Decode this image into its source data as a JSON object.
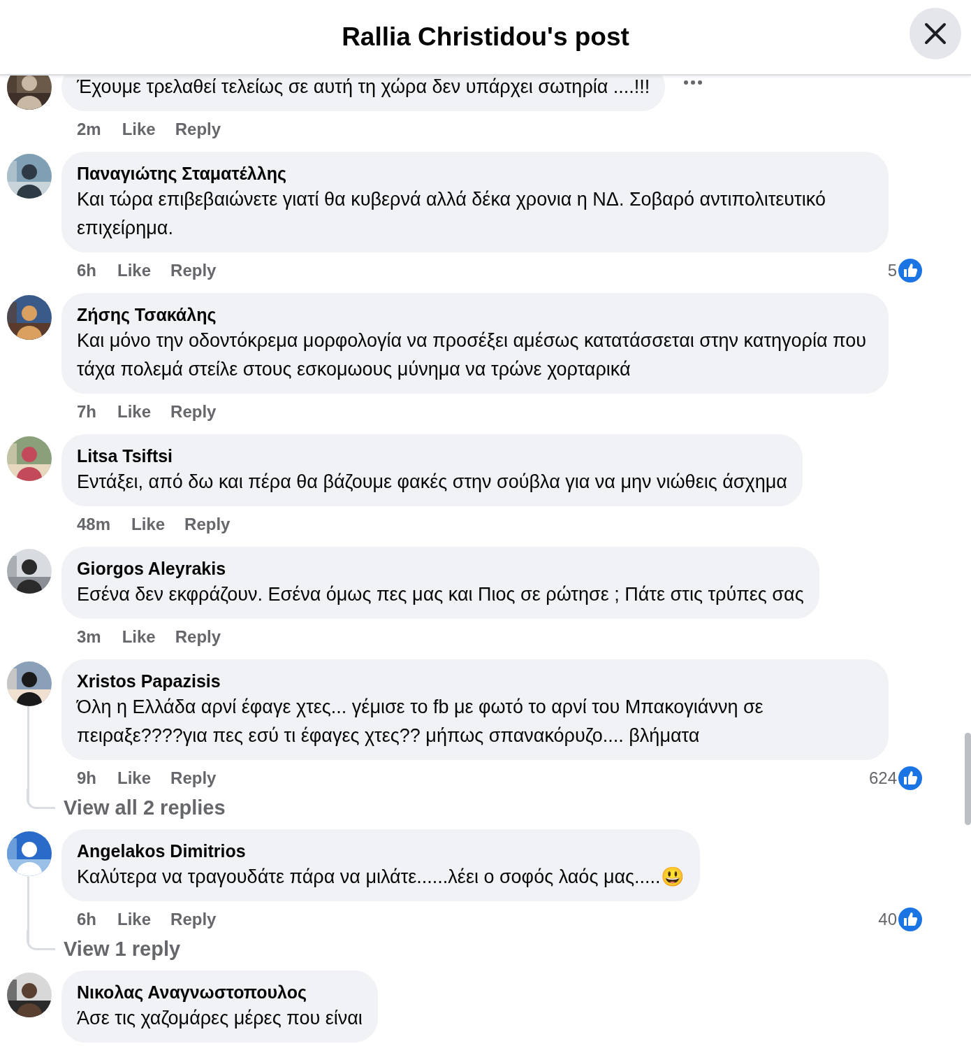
{
  "header": {
    "title": "Rallia Christidou's post"
  },
  "comments": [
    {
      "text": "Έχουμε τρελαθεί τελείως σε αυτή τη χώρα δεν υπάρχει σωτηρία ....!!!",
      "time": "2m",
      "like": "Like",
      "reply": "Reply",
      "menu": true
    },
    {
      "author": "Παναγιώτης Σταματέλλης",
      "text": "Και τώρα επιβεβαιώνετε γιατί θα κυβερνά αλλά δέκα χρονια η ΝΔ. Σοβαρό αντιπολιτευτικό επιχείρημα.",
      "time": "6h",
      "like": "Like",
      "reply": "Reply",
      "reactions": "5",
      "menu": false
    },
    {
      "author": "Ζήσης Τσακάλης",
      "text": "Και μόνο την οδοντόκρεμα μορφολογία να προσέξει αμέσως κατατάσσεται στην κατηγορία που τάχα πολεμά στείλε στους εσκομωους μύνημα να τρώνε χορταρικά",
      "time": "7h",
      "like": "Like",
      "reply": "Reply",
      "menu": false
    },
    {
      "author": "Litsa Tsiftsi",
      "text": "Εντάξει, από δω και πέρα θα βάζουμε φακές στην σούβλα για να μην νιώθεις άσχημα",
      "time": "48m",
      "like": "Like",
      "reply": "Reply",
      "menu": false
    },
    {
      "author": "Giorgos Aleyrakis",
      "text": "Εσένα δεν εκφράζουν. Εσένα όμως πες μας και Πιος σε ρώτησε ; Πάτε στις τρύπες σας",
      "time": "3m",
      "like": "Like",
      "reply": "Reply",
      "menu": false
    },
    {
      "author": "Xristos Papazisis",
      "text": "Όλη η Ελλάδα αρνί έφαγε χτες... γέμισε το fb με φωτό το αρνί του Μπακογιάννη σε πειραξε????για πες εσύ τι έφαγες χτες?? μήπως σπανακόρυζο.... βλήματα",
      "time": "9h",
      "like": "Like",
      "reply": "Reply",
      "reactions": "624",
      "replies_link": "View all 2 replies",
      "menu": false
    },
    {
      "author": "Angelakos Dimitrios",
      "text": "Καλύτερα να τραγουδάτε πάρα να μιλάτε......λέει ο σοφός λαός μας.....😃",
      "time": "6h",
      "like": "Like",
      "reply": "Reply",
      "reactions": "40",
      "replies_link": "View 1 reply",
      "menu": false
    },
    {
      "author": "Νικολας Αναγνωστοπουλος",
      "text": "Άσε τις χαζομάρες μέρες που είναι",
      "menu": false
    }
  ]
}
